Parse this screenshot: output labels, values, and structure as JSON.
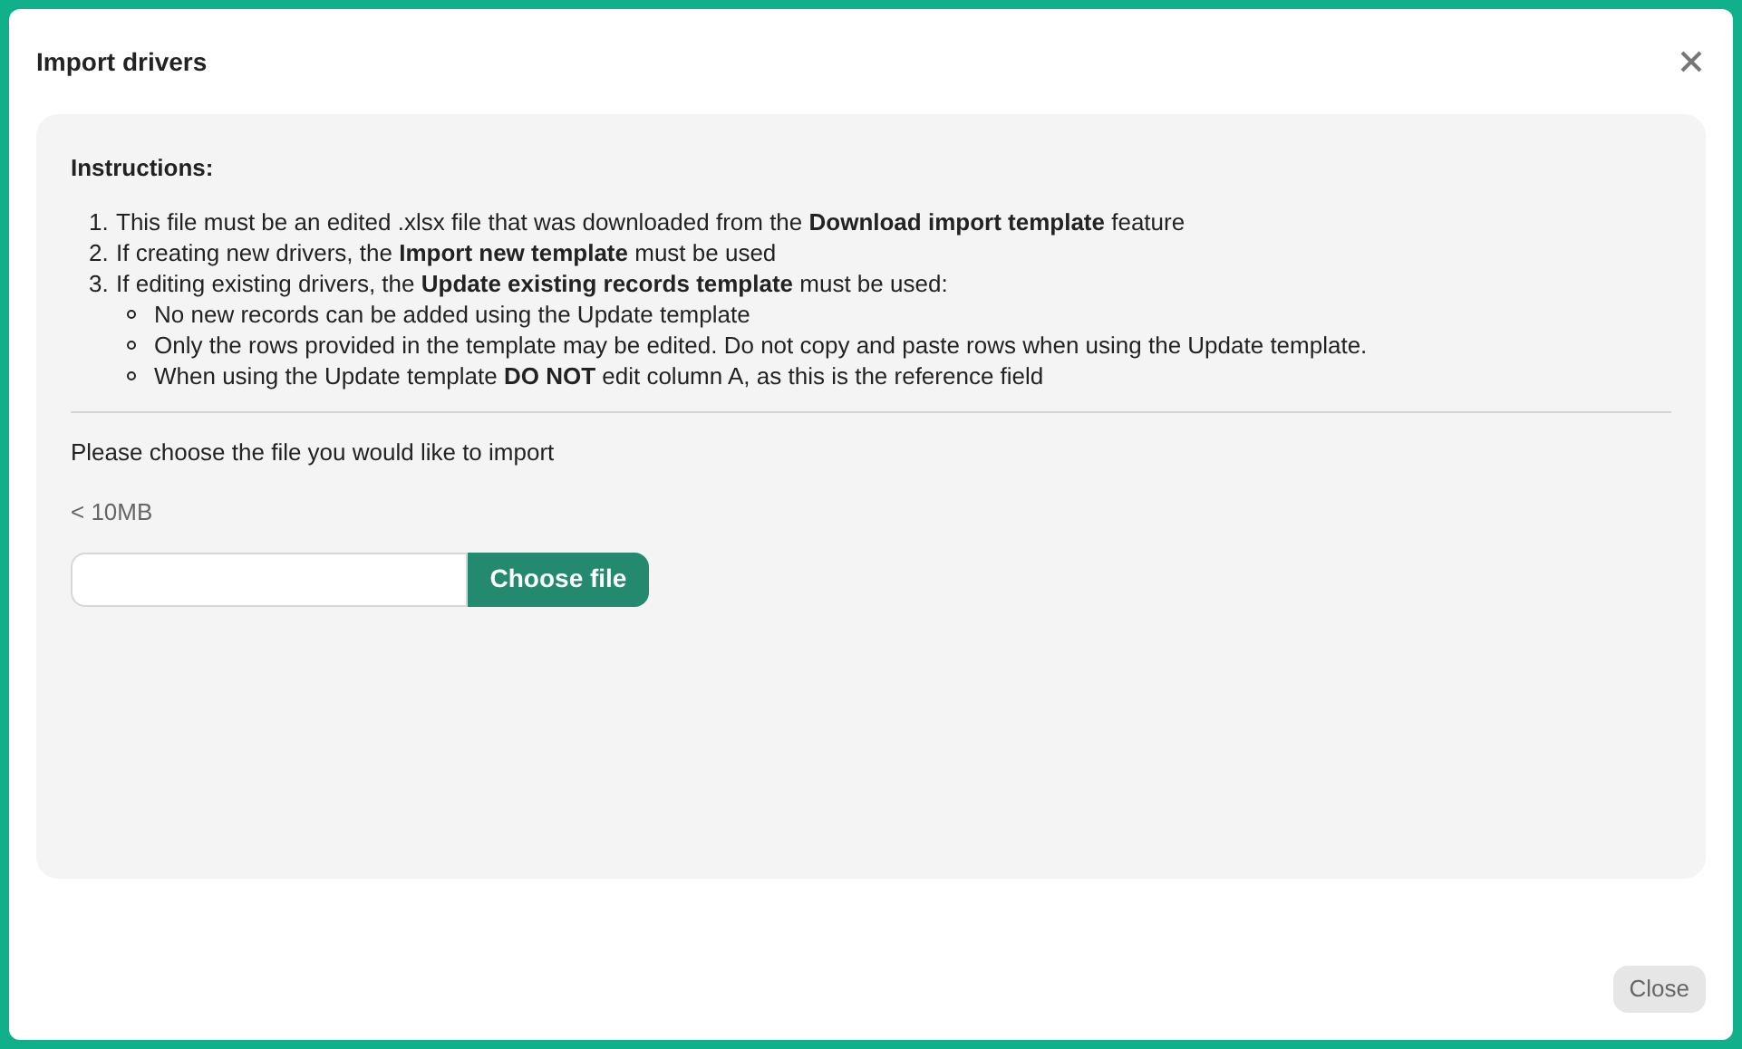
{
  "dialog": {
    "title": "Import drivers"
  },
  "instructions": {
    "heading": "Instructions:",
    "steps": [
      {
        "number": "1.",
        "text": "This file must be an edited .xlsx file that was downloaded from the **Download import template** feature"
      },
      {
        "number": "2.",
        "text": "If creating new drivers, the **Import new template** must be used"
      },
      {
        "number": "3.",
        "text": "If editing existing drivers, the **Update existing records template** must be used:",
        "children": [
          {
            "text": "No new records can be added using the Update template"
          },
          {
            "text": "Only the rows provided in the template may be edited. Do not copy and paste rows when using the Update template."
          },
          {
            "text": "When using the Update template **DO NOT** edit column A, as this is the reference field"
          }
        ]
      }
    ]
  },
  "upload": {
    "prompt": "Please choose the file you would like to import",
    "size_hint": "< 10MB",
    "button": "Choose file"
  },
  "footer": {
    "button": "Close"
  }
}
